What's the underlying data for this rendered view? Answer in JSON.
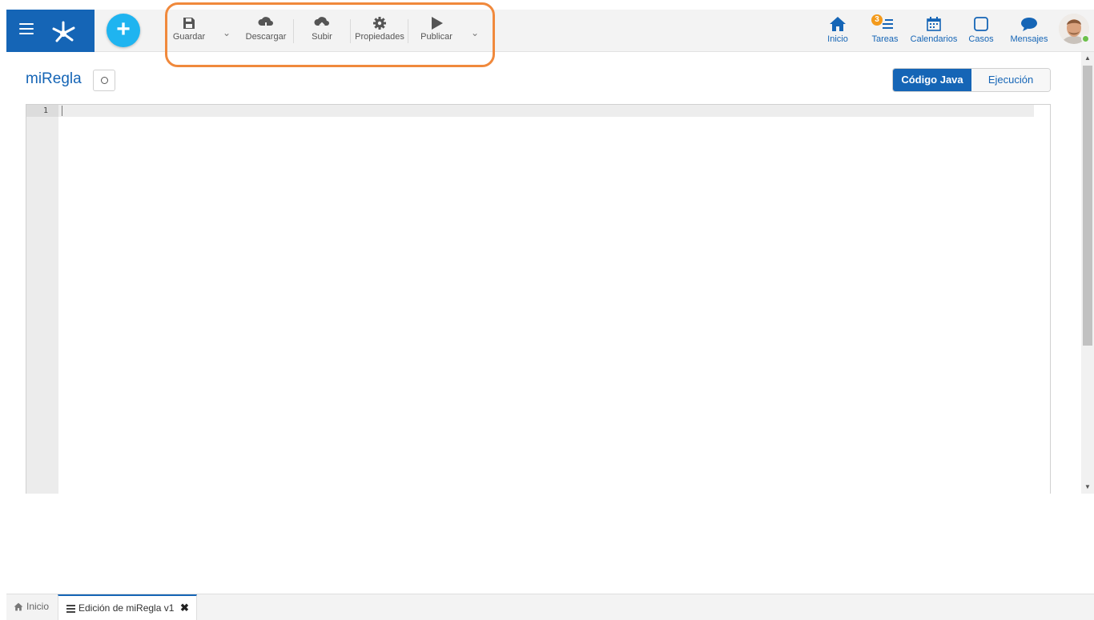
{
  "toolbar": {
    "save_label": "Guardar",
    "download_label": "Descargar",
    "upload_label": "Subir",
    "properties_label": "Propiedades",
    "publish_label": "Publicar"
  },
  "nav": {
    "home_label": "Inicio",
    "tasks_label": "Tareas",
    "tasks_count": "3",
    "calendars_label": "Calendarios",
    "cases_label": "Casos",
    "messages_label": "Mensajes"
  },
  "page": {
    "title": "miRegla",
    "tabs": [
      {
        "label": "Código Java",
        "active": true
      },
      {
        "label": "Ejecución",
        "active": false
      }
    ]
  },
  "editor": {
    "line_numbers": [
      "1"
    ],
    "content": ""
  },
  "bottom_tabs": {
    "home_label": "Inicio",
    "current_label": "Edición de miRegla v1"
  },
  "colors": {
    "brand_blue": "#1565b6",
    "add_button": "#1fb4f0",
    "highlight_orange": "#f0893c",
    "badge_orange": "#f39a1b",
    "presence_green": "#6cc04a"
  },
  "icons": {
    "menu": "hamburger-icon",
    "logo": "app-logo-icon",
    "add": "plus-icon",
    "save": "floppy-disk-icon",
    "download": "cloud-download-icon",
    "upload": "cloud-upload-icon",
    "properties": "gear-icon",
    "publish": "play-icon",
    "home": "home-icon",
    "tasks": "tasks-list-icon",
    "calendars": "calendar-icon",
    "cases": "square-icon",
    "messages": "speech-bubble-icon"
  }
}
